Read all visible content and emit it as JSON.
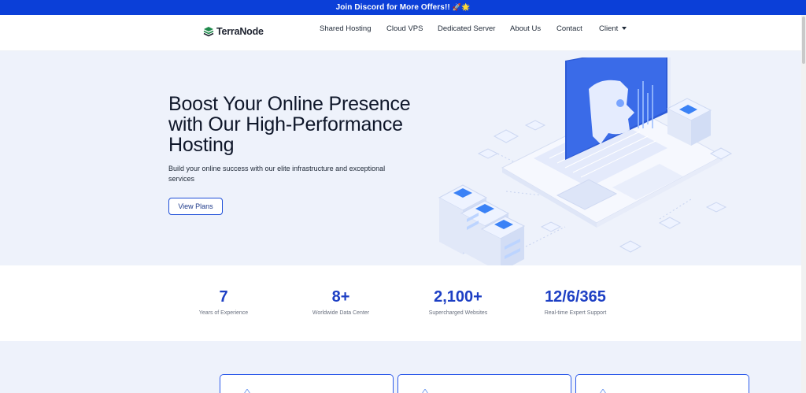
{
  "promo": {
    "text": "Join Discord for More Offers!!",
    "emoji": "🚀🌟"
  },
  "nav": {
    "brand": "TerraNode",
    "items": [
      "Shared Hosting",
      "Cloud VPS",
      "Dedicated Server",
      "About Us",
      "Contact"
    ],
    "client": "Client"
  },
  "hero": {
    "title": "Boost Your Online Presence with Our High-Performance Hosting",
    "subtitle": "Build your online success with our elite infrastructure and exceptional services",
    "button": "View Plans"
  },
  "stats": [
    {
      "value": "7",
      "label": "Years of Experience"
    },
    {
      "value": "8+",
      "label": "Worldwide Data Center"
    },
    {
      "value": "2,100+",
      "label": "Supercharged Websites"
    },
    {
      "value": "12/6/365",
      "label": "Real-time Expert Support"
    }
  ],
  "colors": {
    "primary": "#0b3fd8",
    "accent": "#1d3fc4",
    "hero_bg": "#eef2fb"
  }
}
